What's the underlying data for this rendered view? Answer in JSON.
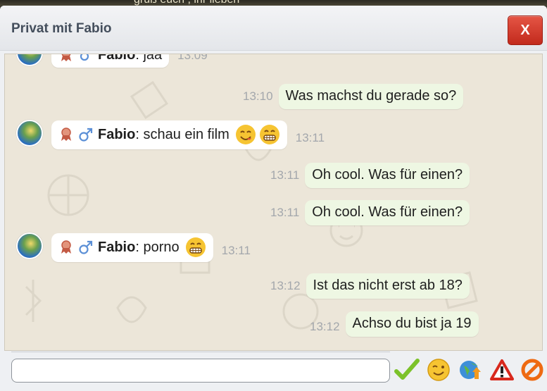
{
  "background": {
    "partial_text": "gruß euch , ihr lieben"
  },
  "window": {
    "title": "Privat mit Fabio",
    "close_label": "X"
  },
  "messages": [
    {
      "direction": "in",
      "sender": "Fabio",
      "text": "jaa",
      "time": "13:09",
      "partial": true
    },
    {
      "direction": "out",
      "text": "Was machst du gerade so?",
      "time": "13:10"
    },
    {
      "direction": "in",
      "sender": "Fabio",
      "text": "schau ein film",
      "time": "13:11",
      "emojis": [
        "yum-face",
        "grin-face"
      ]
    },
    {
      "direction": "out",
      "text": "Oh cool. Was für einen?",
      "time": "13:11"
    },
    {
      "direction": "out",
      "text": "Oh cool. Was für einen?",
      "time": "13:11"
    },
    {
      "direction": "in",
      "sender": "Fabio",
      "text": "porno",
      "time": "13:11",
      "emojis": [
        "grin-face"
      ]
    },
    {
      "direction": "out",
      "text": "Ist das nicht erst ab 18?",
      "time": "13:12"
    },
    {
      "direction": "out",
      "text": "Achso du bist ja 19",
      "time": "13:12"
    }
  ],
  "colon": ":",
  "input": {
    "value": "",
    "placeholder": ""
  },
  "toolbar": {
    "send_icon": "checkmark-icon",
    "emoji_icon": "smiley-icon",
    "globe_icon": "globe-icon",
    "report_icon": "warning-icon",
    "block_icon": "block-icon"
  },
  "colors": {
    "close": "#d23a2b",
    "chat_bg": "#ece6d9",
    "out_bubble": "#eef7e3",
    "in_bubble": "#ffffff"
  }
}
